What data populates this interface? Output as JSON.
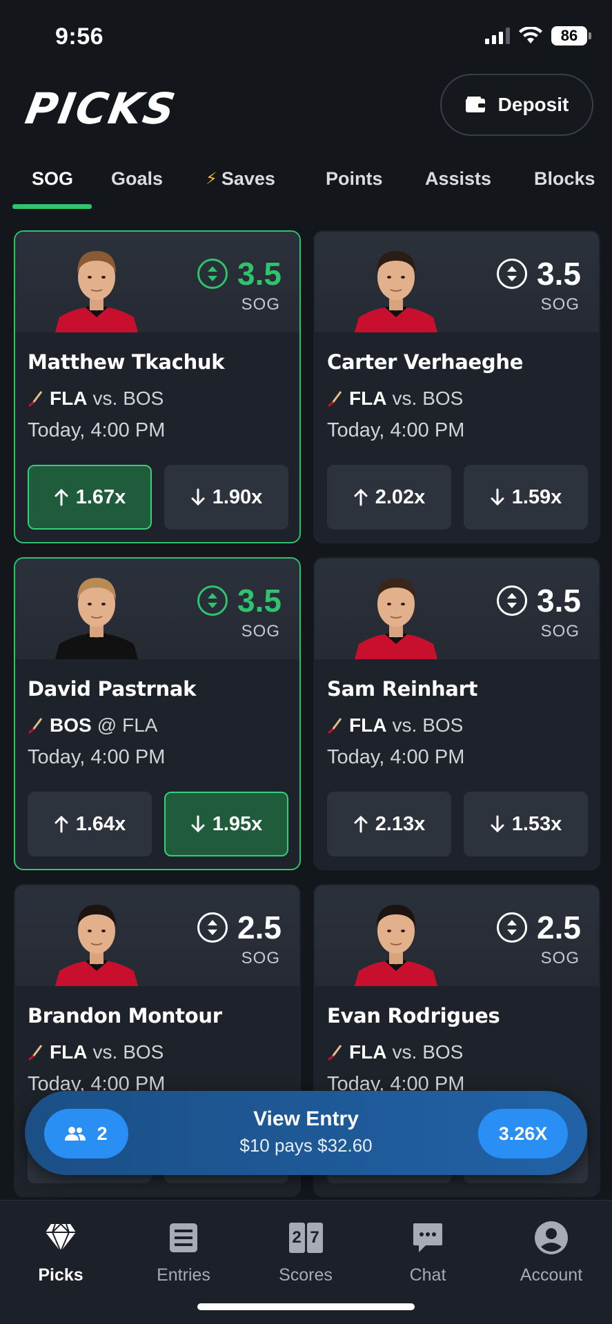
{
  "status": {
    "time": "9:56",
    "battery": "86"
  },
  "header": {
    "logo": "PICKS",
    "deposit_label": "Deposit"
  },
  "tabs": [
    {
      "label": "SOG",
      "active": true
    },
    {
      "label": "Goals"
    },
    {
      "label": "Saves",
      "icon": "lightning-icon"
    },
    {
      "label": "Points"
    },
    {
      "label": "Assists"
    },
    {
      "label": "Blocks"
    }
  ],
  "cards": [
    {
      "name": "Matthew Tkachuk",
      "line": "3.5",
      "stat": "SOG",
      "team": "FLA",
      "sep": "vs.",
      "opp": "BOS",
      "time": "Today, 4:00 PM",
      "more": "1.67x",
      "less": "1.90x",
      "selected": "more",
      "hair": "#8a5a34",
      "jersey": "#c8102e"
    },
    {
      "name": "Carter Verhaeghe",
      "line": "3.5",
      "stat": "SOG",
      "team": "FLA",
      "sep": "vs.",
      "opp": "BOS",
      "time": "Today, 4:00 PM",
      "more": "2.02x",
      "less": "1.59x",
      "selected": "",
      "hair": "#2a1d15",
      "jersey": "#c8102e"
    },
    {
      "name": "David Pastrnak",
      "line": "3.5",
      "stat": "SOG",
      "team": "BOS",
      "sep": "@",
      "opp": "FLA",
      "time": "Today, 4:00 PM",
      "more": "1.64x",
      "less": "1.95x",
      "selected": "less",
      "hair": "#b88a55",
      "jersey": "#111111"
    },
    {
      "name": "Sam Reinhart",
      "line": "3.5",
      "stat": "SOG",
      "team": "FLA",
      "sep": "vs.",
      "opp": "BOS",
      "time": "Today, 4:00 PM",
      "more": "2.13x",
      "less": "1.53x",
      "selected": "",
      "hair": "#3a2618",
      "jersey": "#c8102e"
    },
    {
      "name": "Brandon Montour",
      "line": "2.5",
      "stat": "SOG",
      "team": "FLA",
      "sep": "vs.",
      "opp": "BOS",
      "time": "Today, 4:00 PM",
      "more": "",
      "less": "",
      "selected": "",
      "hair": "#1c1410",
      "jersey": "#c8102e"
    },
    {
      "name": "Evan Rodrigues",
      "line": "2.5",
      "stat": "SOG",
      "team": "FLA",
      "sep": "vs.",
      "opp": "BOS",
      "time": "Today, 4:00 PM",
      "more": "",
      "less": "",
      "selected": "",
      "hair": "#1c1410",
      "jersey": "#c8102e"
    }
  ],
  "entry": {
    "count": "2",
    "title": "View Entry",
    "subtitle": "$10 pays $32.60",
    "multiplier": "3.26X"
  },
  "nav": [
    {
      "label": "Picks",
      "icon": "diamond-icon",
      "active": true
    },
    {
      "label": "Entries",
      "icon": "list-icon"
    },
    {
      "label": "Scores",
      "icon": "scoreboard-icon",
      "digits": [
        "2",
        "7"
      ]
    },
    {
      "label": "Chat",
      "icon": "chat-icon"
    },
    {
      "label": "Account",
      "icon": "account-icon"
    }
  ],
  "colors": {
    "accent_green": "#2fc46b",
    "entry_blue": "#2a8ff5",
    "background": "#13161b",
    "card": "#1e232b"
  }
}
